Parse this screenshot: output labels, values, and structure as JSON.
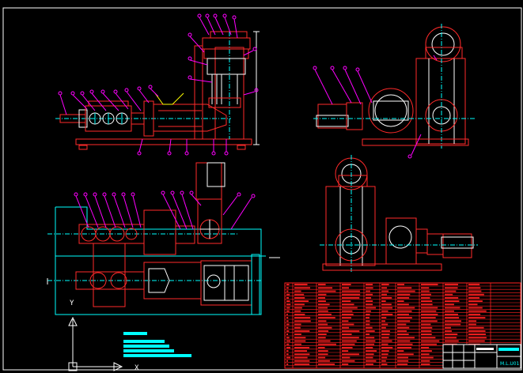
{
  "drawing": {
    "background": "#000000",
    "colors": {
      "frame": "#ffffff",
      "outline": "#ff2a2a",
      "leader": "#ff00ff",
      "center": "#00ffff",
      "detail": "#ffffff",
      "dim": "#00ff00",
      "table": "#ff2020",
      "title_block": "#ffffff",
      "notes": "#00ffff",
      "accent": "#ffff00"
    },
    "ucs_axis": {
      "x_label": "X",
      "y_label": "Y"
    },
    "title_block": {
      "code": "M.L.U01"
    },
    "views": [
      "front-elevation-view",
      "plan-view",
      "side-view-upper-right",
      "side-view-lower-right"
    ]
  }
}
